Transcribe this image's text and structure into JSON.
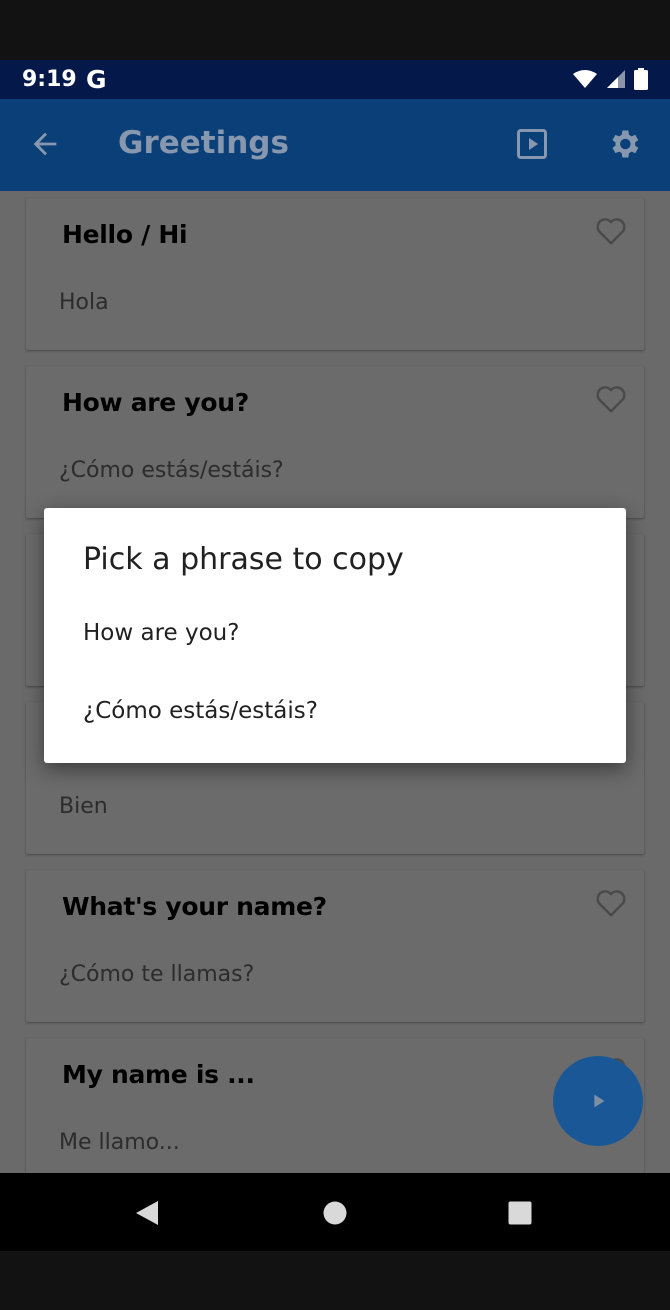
{
  "status_bar": {
    "time": "9:19",
    "g_logo": "G",
    "icons": [
      "wifi-icon",
      "signal-icon",
      "battery-icon"
    ]
  },
  "app_bar": {
    "title": "Greetings",
    "icons": [
      "back-arrow-icon",
      "play-box-icon",
      "gear-icon"
    ]
  },
  "cards": [
    {
      "english": "Hello / Hi",
      "spanish": "Hola"
    },
    {
      "english": "How are you?",
      "spanish": "¿Cómo estás/estáis?"
    },
    {
      "english": "",
      "spanish": ""
    },
    {
      "english": "",
      "spanish": "Bien"
    },
    {
      "english": "What's your name?",
      "spanish": "¿Cómo te llamas?"
    },
    {
      "english": "My name is ...",
      "spanish": "Me llamo..."
    }
  ],
  "dialog": {
    "title": "Pick a phrase to copy",
    "options": [
      "How are you?",
      "¿Cómo estás/estáis?"
    ]
  },
  "fab": {
    "icon": "play-icon"
  },
  "nav_bar": {
    "icons": [
      "nav-back-icon",
      "nav-home-icon",
      "nav-recents-icon"
    ]
  },
  "colors": {
    "status_bar": "#04194a",
    "app_bar": "#0b3f78",
    "fab": "#1a5797",
    "scrim": "#6a6a6a",
    "dialog": "#ffffff"
  }
}
